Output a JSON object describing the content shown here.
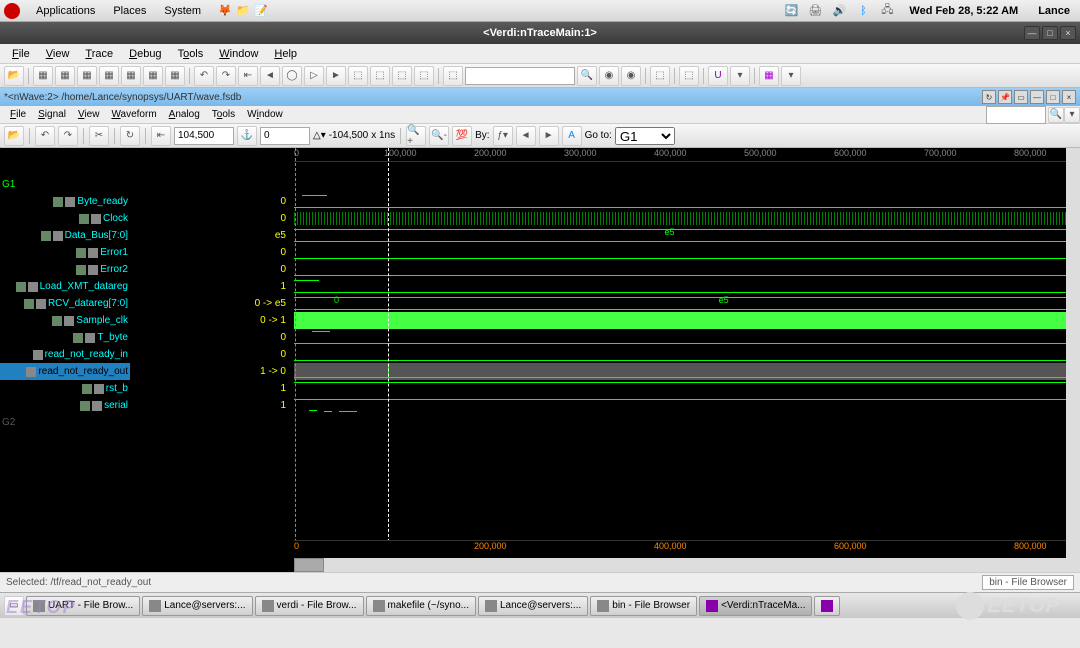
{
  "gnome": {
    "apps": "Applications",
    "places": "Places",
    "system": "System",
    "clock": "Wed Feb 28,  5:22 AM",
    "user": "Lance"
  },
  "window": {
    "title": "<Verdi:nTraceMain:1>"
  },
  "menubar": {
    "file": "File",
    "view": "View",
    "trace": "Trace",
    "debug": "Debug",
    "tools": "Tools",
    "window": "Window",
    "help": "Help"
  },
  "subwin": {
    "path": "*<nWave:2> /home/Lance/synopsys/UART/wave.fsdb"
  },
  "submenu": {
    "file": "File",
    "signal": "Signal",
    "view": "View",
    "waveform": "Waveform",
    "analog": "Analog",
    "tools": "Tools",
    "window": "Window"
  },
  "wave_toolbar": {
    "time": "104,500",
    "cursor2": "0",
    "delta": "-104,500",
    "unit": "x 1ns",
    "by_label": "By:",
    "goto_label": "Go to:",
    "goto_value": "G1"
  },
  "ruler": {
    "ticks": [
      "0",
      "100,000",
      "200,000",
      "300,000",
      "400,000",
      "500,000",
      "600,000",
      "700,000",
      "800,000"
    ]
  },
  "signals": {
    "group1": "G1",
    "items": [
      {
        "name": "Byte_ready",
        "val": "0"
      },
      {
        "name": "Clock",
        "val": "0"
      },
      {
        "name": "Data_Bus[7:0]",
        "val": "e5"
      },
      {
        "name": "Error1",
        "val": "0"
      },
      {
        "name": "Error2",
        "val": "0"
      },
      {
        "name": "Load_XMT_datareg",
        "val": "1"
      },
      {
        "name": "RCV_datareg[7:0]",
        "val": "0 -> e5"
      },
      {
        "name": "Sample_clk",
        "val": "0 -> 1"
      },
      {
        "name": "T_byte",
        "val": "0"
      },
      {
        "name": "read_not_ready_in",
        "val": "0"
      },
      {
        "name": "read_not_ready_out",
        "val": "1 -> 0",
        "selected": true
      },
      {
        "name": "rst_b",
        "val": "1"
      },
      {
        "name": "serial",
        "val": "1"
      }
    ],
    "group2": "G2",
    "bus_labels": {
      "e5_a": "e5",
      "zero": "0",
      "e5_b": "e5"
    }
  },
  "status": {
    "selected": "Selected: /tf/read_not_ready_out",
    "right": "bin - File Browser"
  },
  "taskbar": [
    "UART - File Brow...",
    "Lance@servers:...",
    "verdi - File Brow...",
    "makefile (~/syno...",
    "Lance@servers:...",
    "bin - File Browser",
    "<Verdi:nTraceMa...",
    ""
  ],
  "watermark": {
    "left": "EETOP",
    "right": "EETOP"
  }
}
